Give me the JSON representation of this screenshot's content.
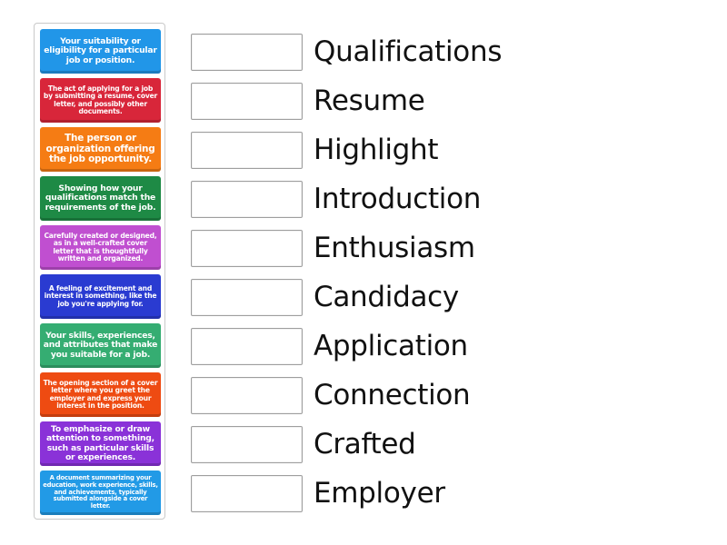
{
  "activity": {
    "type": "match-up",
    "cards": [
      {
        "text": "Your suitability or eligibility for a particular job or position.",
        "color": "#2196e8"
      },
      {
        "text": "The act of applying for a job by submitting a resume, cover letter, and possibly other documents.",
        "color": "#d8263a"
      },
      {
        "text": "The person or organization offering the job opportunity.",
        "color": "#f57c14"
      },
      {
        "text": "Showing how your qualifications match the requirements of the job.",
        "color": "#1e8a45"
      },
      {
        "text": "Carefully created or designed, as in a well-crafted cover letter that is thoughtfully written and organized.",
        "color": "#c04fd0"
      },
      {
        "text": "A feeling of excitement and interest in something, like the job you're applying for.",
        "color": "#2a3bd1"
      },
      {
        "text": "Your skills, experiences, and attributes that make you suitable for a job.",
        "color": "#35ad72"
      },
      {
        "text": "The opening section of a cover letter where you greet the employer and express your interest in the position.",
        "color": "#ee4b12"
      },
      {
        "text": "To emphasize or draw attention to something, such as particular skills or experiences.",
        "color": "#8a32d8"
      },
      {
        "text": "A document summarizing your education, work experience, skills, and achievements, typically submitted alongside a cover letter.",
        "color": "#229ae6"
      }
    ],
    "terms": [
      "Qualifications",
      "Resume",
      "Highlight",
      "Introduction",
      "Enthusiasm",
      "Candidacy",
      "Application",
      "Connection",
      "Crafted",
      "Employer"
    ]
  }
}
